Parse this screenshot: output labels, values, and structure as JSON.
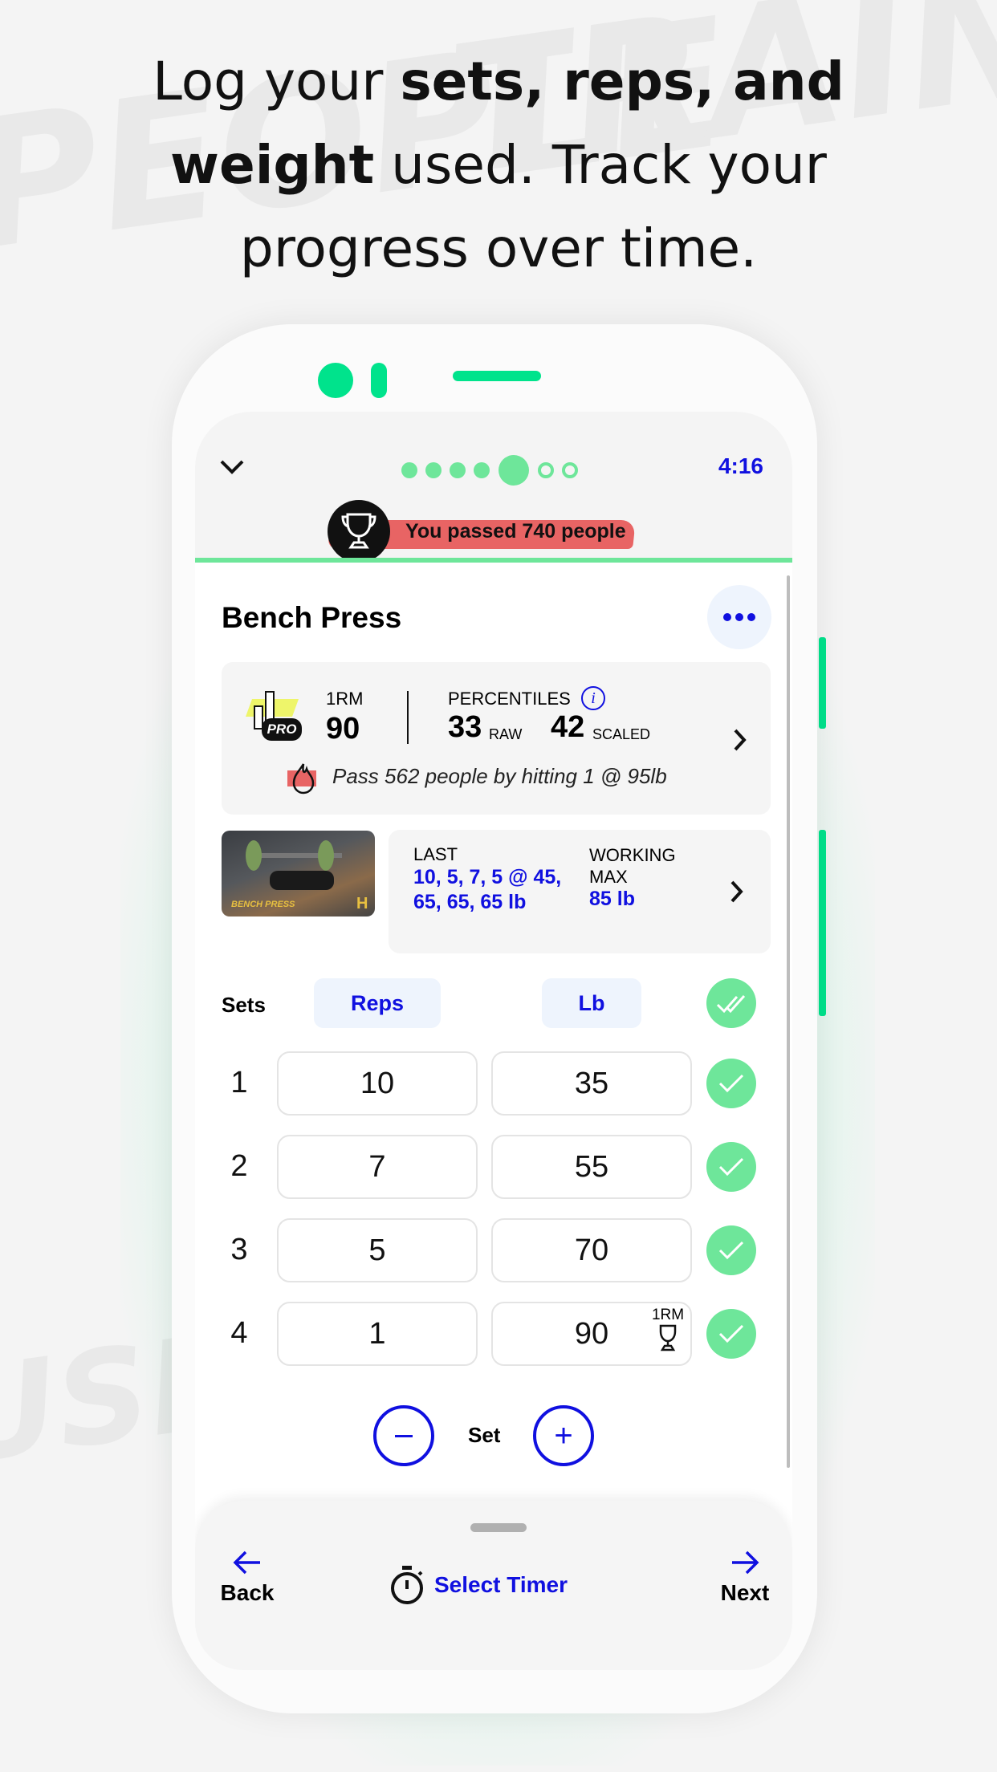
{
  "headline": {
    "line1_pre": "Log your ",
    "line1_bold": "sets, reps, and",
    "line2_bold": "weight",
    "line2_post": " used. Track your",
    "line3": "progress over time."
  },
  "colors": {
    "accent_green": "#6ee69a",
    "brand_blue": "#1010e0",
    "banner_red": "#e86464",
    "phone_green": "#00e38c"
  },
  "header": {
    "timer": "4:16",
    "progress_total": 7,
    "progress_current": 5,
    "banner": "You passed 740 people"
  },
  "exercise": {
    "title": "Bench Press"
  },
  "stats": {
    "one_rm_label": "1RM",
    "one_rm_value": "90",
    "percentiles_label": "PERCENTILES",
    "raw_value": "33",
    "raw_label": "RAW",
    "scaled_value": "42",
    "scaled_label": "SCALED",
    "pro_badge": "PRO",
    "tip": "Pass 562 people by hitting 1 @ 95lb"
  },
  "history": {
    "thumb_caption": "BENCH PRESS",
    "last_label": "LAST",
    "last_value": "10, 5, 7, 5 @ 45, 65, 65, 65 lb",
    "working_max_label": "WORKING MAX",
    "working_max_value": "85 lb"
  },
  "sets_table": {
    "sets_label": "Sets",
    "reps_label": "Reps",
    "lb_label": "Lb",
    "rows": [
      {
        "set": "1",
        "reps": "10",
        "lb": "35"
      },
      {
        "set": "2",
        "reps": "7",
        "lb": "55"
      },
      {
        "set": "3",
        "reps": "5",
        "lb": "70"
      },
      {
        "set": "4",
        "reps": "1",
        "lb": "90",
        "badge": "1RM"
      }
    ]
  },
  "set_control": {
    "label": "Set"
  },
  "footer": {
    "back": "Back",
    "timer": "Select Timer",
    "next": "Next"
  }
}
